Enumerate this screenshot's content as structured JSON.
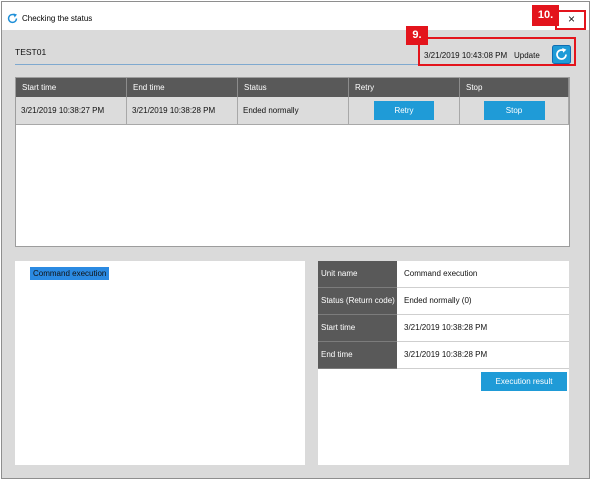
{
  "window": {
    "title": "Checking the status",
    "close_label": "×"
  },
  "header": {
    "job_name": "TEST01",
    "last_updated": "3/21/2019 10:43:08 PM",
    "update_label": "Update"
  },
  "history_table": {
    "columns": [
      "Start time",
      "End time",
      "Status",
      "Retry",
      "Stop"
    ],
    "rows": [
      {
        "start_time": "3/21/2019 10:38:27 PM",
        "end_time": "3/21/2019 10:38:28 PM",
        "status": "Ended normally",
        "retry_label": "Retry",
        "stop_label": "Stop"
      }
    ]
  },
  "tree": {
    "items": [
      {
        "label": "Command execution",
        "selected": true
      }
    ]
  },
  "details": {
    "rows": [
      {
        "label": "Unit name",
        "value": "Command execution"
      },
      {
        "label": "Status (Return code)",
        "value": "Ended normally (0)"
      },
      {
        "label": "Start time",
        "value": "3/21/2019 10:38:28 PM"
      },
      {
        "label": "End time",
        "value": "3/21/2019 10:38:28 PM"
      }
    ],
    "execution_result_label": "Execution result"
  },
  "annotations": {
    "update_tag": "9.",
    "close_tag": "10."
  },
  "icons": {
    "title": "refresh-circle-icon",
    "update": "refresh-icon",
    "close": "close-icon"
  },
  "colors": {
    "accent": "#1f9bd7",
    "header_bg": "#595959",
    "panel_bg": "#dadada",
    "annotation_red": "#e3141c",
    "selection": "#2b8ae2"
  }
}
